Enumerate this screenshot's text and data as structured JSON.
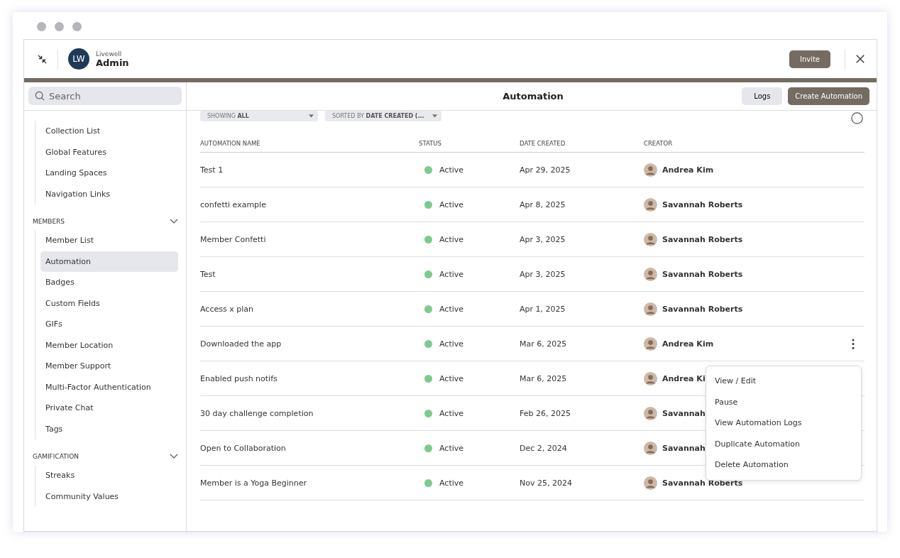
{
  "header": {
    "org": "Livewell",
    "title": "Admin",
    "logo": "LW",
    "invite": "Invite"
  },
  "search": {
    "placeholder": "Search"
  },
  "sidebar": {
    "sections": [
      {
        "items": [
          {
            "label": "Collection List",
            "selected": false
          },
          {
            "label": "Global Features",
            "selected": false
          },
          {
            "label": "Landing Spaces",
            "selected": false
          },
          {
            "label": "Navigation Links",
            "selected": false
          }
        ]
      },
      {
        "heading": "MEMBERS",
        "expanded": true,
        "items": [
          {
            "label": "Member List",
            "selected": false
          },
          {
            "label": "Automation",
            "selected": true
          },
          {
            "label": "Badges",
            "selected": false
          },
          {
            "label": "Custom Fields",
            "selected": false
          },
          {
            "label": "GIFs",
            "selected": false
          },
          {
            "label": "Member Location",
            "selected": false
          },
          {
            "label": "Member Support",
            "selected": false
          },
          {
            "label": "Multi-Factor Authentication",
            "selected": false
          },
          {
            "label": "Private Chat",
            "selected": false
          },
          {
            "label": "Tags",
            "selected": false
          }
        ]
      },
      {
        "heading": "GAMIFICATION",
        "expanded": true,
        "items": [
          {
            "label": "Streaks",
            "selected": false
          },
          {
            "label": "Community Values",
            "selected": false
          }
        ]
      }
    ]
  },
  "page": {
    "title": "Automation",
    "logs": "Logs",
    "create": "Create Automation"
  },
  "filters": [
    {
      "prefix": "SHOWING",
      "value": "ALL"
    },
    {
      "prefix": "SORTED BY",
      "value": "DATE CREATED (..."
    }
  ],
  "table": {
    "columns": [
      "AUTOMATION NAME",
      "STATUS",
      "DATE CREATED",
      "CREATOR"
    ],
    "rows": [
      {
        "name": "Test 1",
        "status": "Active",
        "date": "Apr 29, 2025",
        "creator": "Andrea Kim"
      },
      {
        "name": "confetti example",
        "status": "Active",
        "date": "Apr 8, 2025",
        "creator": "Savannah Roberts"
      },
      {
        "name": "Member Confetti",
        "status": "Active",
        "date": "Apr 3, 2025",
        "creator": "Savannah Roberts"
      },
      {
        "name": "Test",
        "status": "Active",
        "date": "Apr 3, 2025",
        "creator": "Savannah Roberts"
      },
      {
        "name": "Access x plan",
        "status": "Active",
        "date": "Apr 1, 2025",
        "creator": "Savannah Roberts"
      },
      {
        "name": "Downloaded the app",
        "status": "Active",
        "date": "Mar 6, 2025",
        "creator": "Andrea Kim",
        "menu": {
          "items": [
            "View / Edit",
            "Pause",
            "View Automation Logs",
            "Duplicate Automation",
            "Delete Automation"
          ]
        }
      },
      {
        "name": "Enabled push notifs",
        "status": "Active",
        "date": "Mar 6, 2025",
        "creator": "Andrea Ki"
      },
      {
        "name": "30 day challenge completion",
        "status": "Active",
        "date": "Feb 26, 2025",
        "creator": "Savannah"
      },
      {
        "name": "Open to Collaboration",
        "status": "Active",
        "date": "Dec 2, 2024",
        "creator": "Savannah"
      },
      {
        "name": "Member is a Yoga Beginner",
        "status": "Active",
        "date": "Nov 25, 2024",
        "creator": "Savannah Roberts"
      }
    ]
  }
}
